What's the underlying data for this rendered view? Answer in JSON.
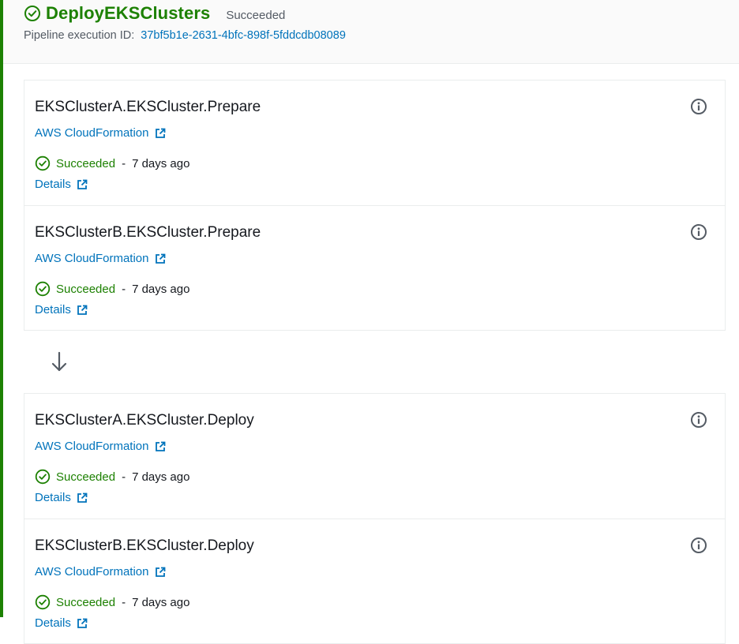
{
  "stage": {
    "name": "DeployEKSClusters",
    "status": "Succeeded",
    "execution_label": "Pipeline execution ID:",
    "execution_id": "37bf5b1e-2631-4bfc-898f-5fddcdb08089"
  },
  "colors": {
    "success": "#1d8102",
    "link": "#0073bb",
    "text": "#16191f",
    "muted": "#545b64",
    "border": "#eaeded"
  },
  "groups": [
    {
      "actions": [
        {
          "name": "EKSClusterA.EKSCluster.Prepare",
          "provider": "AWS CloudFormation",
          "status": "Succeeded",
          "separator": "-",
          "time": "7 days ago",
          "details": "Details",
          "icon": "info-icon"
        },
        {
          "name": "EKSClusterB.EKSCluster.Prepare",
          "provider": "AWS CloudFormation",
          "status": "Succeeded",
          "separator": "-",
          "time": "7 days ago",
          "details": "Details",
          "icon": "info-icon"
        }
      ]
    },
    {
      "actions": [
        {
          "name": "EKSClusterA.EKSCluster.Deploy",
          "provider": "AWS CloudFormation",
          "status": "Succeeded",
          "separator": "-",
          "time": "7 days ago",
          "details": "Details",
          "icon": "info-icon"
        },
        {
          "name": "EKSClusterB.EKSCluster.Deploy",
          "provider": "AWS CloudFormation",
          "status": "Succeeded",
          "separator": "-",
          "time": "7 days ago",
          "details": "Details",
          "icon": "info-icon"
        }
      ]
    }
  ]
}
